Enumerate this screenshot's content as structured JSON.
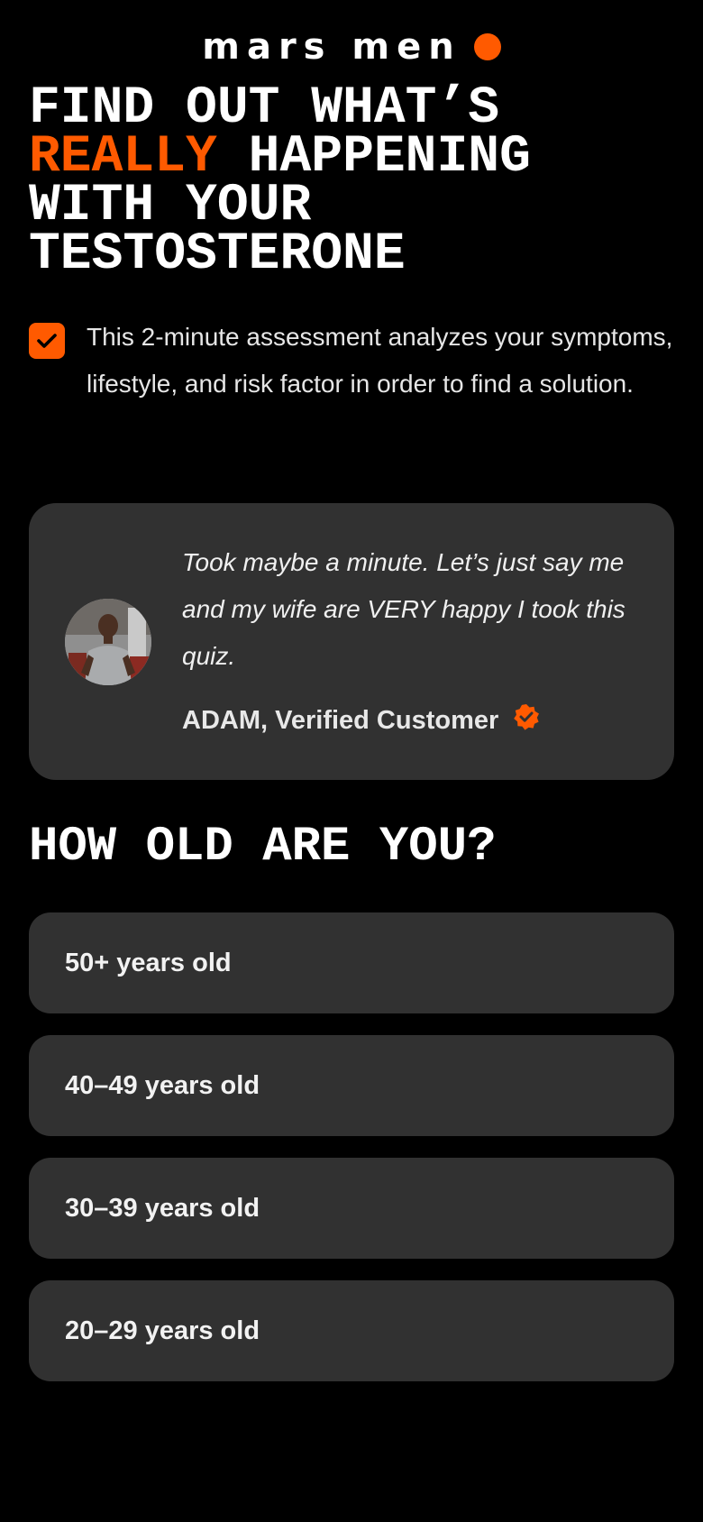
{
  "brand": {
    "name": "mars men",
    "accent_color": "#ff5a00"
  },
  "headline": {
    "line1": "FIND OUT WHAT’S",
    "line2_accent": "REALLY",
    "line2_rest": " HAPPENING",
    "line3": "WITH YOUR",
    "line4": "TESTOSTERONE"
  },
  "intro": {
    "icon": "checkmark-icon",
    "text": "This 2-minute assessment analyzes your symptoms, lifestyle, and risk factor in order to find a solution."
  },
  "review": {
    "quote": "Took maybe a minute. Let’s just say me and my wife are VERY happy I took this quiz.",
    "author": "ADAM, Verified Customer",
    "verified_icon": "verified-badge-icon"
  },
  "question": {
    "title": "HOW OLD ARE YOU?",
    "options": [
      {
        "label": "50+ years old"
      },
      {
        "label": "40–49 years old"
      },
      {
        "label": "30–39 years old"
      },
      {
        "label": "20–29 years old"
      }
    ]
  }
}
